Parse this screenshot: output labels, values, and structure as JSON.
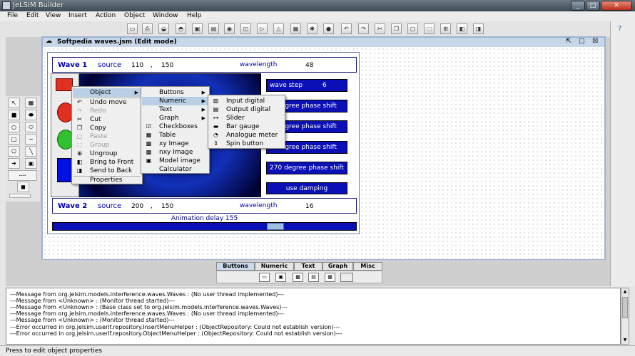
{
  "window": {
    "title": "JeLSIM Builder"
  },
  "menubar": [
    "File",
    "Edit",
    "View",
    "Insert",
    "Action",
    "Object",
    "Window",
    "Help"
  ],
  "toolbar_icons": [
    "new-file-icon",
    "print-icon",
    "icon-a",
    "icon-b",
    "icon-c",
    "icon-d",
    "icon-e",
    "icon-f",
    "icon-g",
    "icon-h",
    "icon-i",
    "icon-j",
    "icon-k",
    "icon-l",
    "icon-m",
    "cut-icon",
    "copy-icon",
    "paste-icon",
    "group-icon",
    "ungroup-icon",
    "front-icon",
    "back-icon"
  ],
  "help_icon": "?",
  "internal_frame": {
    "title": "Softpedia waves.jsm (Edit mode)"
  },
  "wave1": {
    "label": "Wave 1",
    "source_label": "source",
    "x": "110",
    "sep": ",",
    "y": "150",
    "wl_label": "wavelength",
    "wl": "48"
  },
  "wave2": {
    "label": "Wave 2",
    "source_label": "source",
    "x": "200",
    "sep": ",",
    "y": "150",
    "wl_label": "wavelength",
    "wl": "16"
  },
  "right_buttons": [
    {
      "label": "wave step",
      "value": "6"
    },
    {
      "label": "degree phase shift"
    },
    {
      "label": "degree phase shift"
    },
    {
      "label": "degree phase shift"
    },
    {
      "label": "270 degree phase shift"
    },
    {
      "label": "use damping"
    }
  ],
  "animation": {
    "label": "Animation delay 155",
    "value": 155
  },
  "context_menu": {
    "items": [
      {
        "label": "Object",
        "icon": "",
        "submenu": true,
        "highlight": true,
        "disabled": false
      },
      {
        "label": "Undo move",
        "icon": "undo-icon",
        "disabled": false
      },
      {
        "label": "Redo",
        "icon": "redo-icon",
        "disabled": true
      },
      {
        "label": "Cut",
        "icon": "cut-icon",
        "disabled": false
      },
      {
        "label": "Copy",
        "icon": "copy-icon",
        "disabled": false
      },
      {
        "label": "Paste",
        "icon": "paste-icon",
        "disabled": true
      },
      {
        "label": "Group",
        "icon": "group-icon",
        "disabled": true
      },
      {
        "label": "Ungroup",
        "icon": "ungroup-icon",
        "disabled": false
      },
      {
        "label": "Bring to Front",
        "icon": "front-icon",
        "disabled": false
      },
      {
        "label": "Send to Back",
        "icon": "back-icon",
        "disabled": false
      },
      {
        "label": "Properties",
        "icon": "",
        "disabled": false
      }
    ]
  },
  "submenu1": {
    "items": [
      {
        "label": "Buttons",
        "submenu": true,
        "icon": ""
      },
      {
        "label": "Numeric",
        "submenu": true,
        "highlight": true,
        "icon": ""
      },
      {
        "label": "Text",
        "submenu": true,
        "icon": ""
      },
      {
        "label": "Graph",
        "submenu": true,
        "icon": ""
      },
      {
        "label": "Checkboxes",
        "icon": "checkbox-icon"
      },
      {
        "label": "Table",
        "icon": "table-icon"
      },
      {
        "label": "xy Image",
        "icon": "xy-image-icon"
      },
      {
        "label": "nxy Image",
        "icon": "nxy-image-icon"
      },
      {
        "label": "Model image",
        "icon": "model-image-icon"
      },
      {
        "label": "Calculator",
        "icon": ""
      }
    ]
  },
  "submenu2": {
    "items": [
      {
        "label": "Input digital",
        "icon": "input-digital-icon"
      },
      {
        "label": "Output digital",
        "icon": "output-digital-icon"
      },
      {
        "label": "Slider",
        "icon": "slider-icon"
      },
      {
        "label": "Bar gauge",
        "icon": "bar-gauge-icon"
      },
      {
        "label": "Analogue meter",
        "icon": "analogue-meter-icon"
      },
      {
        "label": "Spin button",
        "icon": "spin-button-icon"
      }
    ]
  },
  "palette_tabs": [
    {
      "label": "Buttons",
      "selected": true
    },
    {
      "label": "Numeric"
    },
    {
      "label": "Text"
    },
    {
      "label": "Graph"
    },
    {
      "label": "Misc"
    }
  ],
  "console": [
    "---Message from org.jelsim.models.interference.waves.Waves : (No user thread implemented)---",
    "---Message from <Unknown> : (Monitor thread started)---",
    "---Message from <Unknown> : (Base class set to org.jelsim.models.interference.waves.Waves)---",
    "---Message from org.jelsim.models.interference.waves.Waves : (No user thread implemented)---",
    "---Message from <Unknown> : (Monitor thread started)---",
    "---Error occurred in org.jelsim.userif.repository.InsertMenuHelper : (ObjectRepository: Could not establish version)---",
    "---Error occurred in org.jelsim.userif.repository.ObjectMenuHelper : (ObjectRepository: Could not establish version)---"
  ],
  "status": "Press to edit object properties"
}
